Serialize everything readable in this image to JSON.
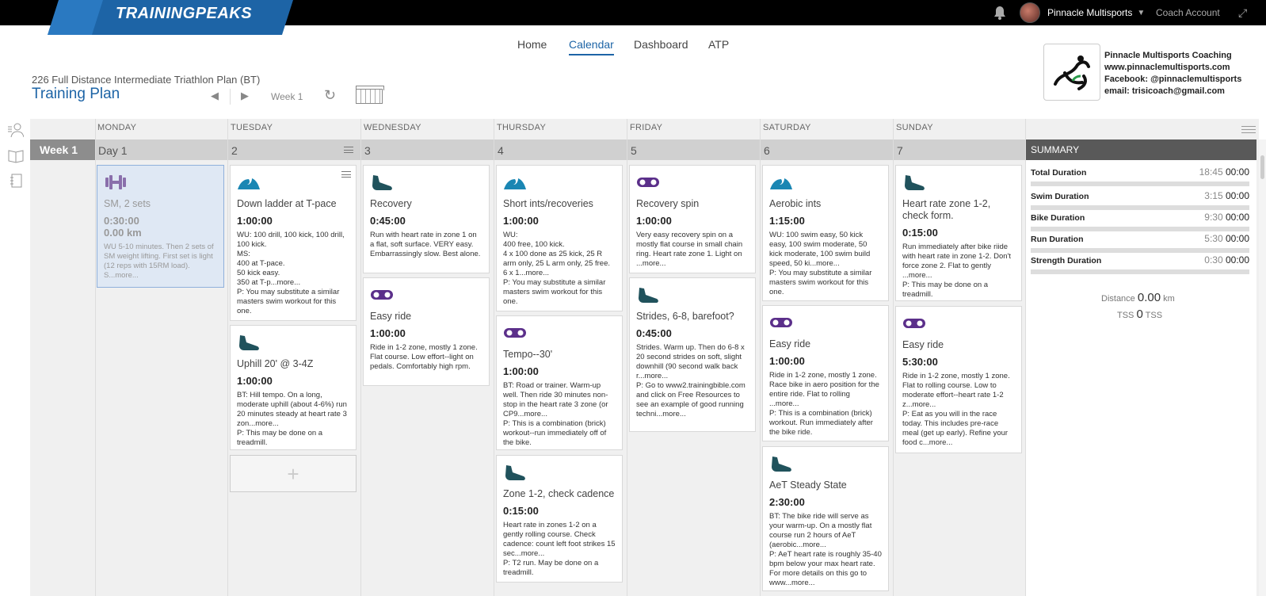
{
  "brand": "TRAININGPEAKS",
  "topbar": {
    "account_name": "Pinnacle Multisports",
    "coach_account": "Coach Account"
  },
  "nav": [
    {
      "label": "Home"
    },
    {
      "label": "Calendar"
    },
    {
      "label": "Dashboard"
    },
    {
      "label": "ATP"
    }
  ],
  "plan": {
    "subtitle": "226 Full Distance Intermediate Triathlon Plan (BT)",
    "title": "Training Plan",
    "week_label": "Week 1"
  },
  "coach_info": {
    "name": "Pinnacle Multisports Coaching",
    "website": "www.pinnaclemultisports.com",
    "facebook": "Facebook: @pinnaclemultisports",
    "email": "email: trisicoach@gmail.com"
  },
  "days": [
    "MONDAY",
    "TUESDAY",
    "WEDNESDAY",
    "THURSDAY",
    "FRIDAY",
    "SATURDAY",
    "SUNDAY"
  ],
  "week": {
    "label": "Week 1",
    "day_numbers": [
      "Day 1",
      "2",
      "3",
      "4",
      "5",
      "6",
      "7"
    ]
  },
  "colors": {
    "swim": "#1a86b3",
    "bike": "#5b2f8a",
    "run": "#20525c",
    "strength": "#8a6fab",
    "accent": "#1d64a6"
  },
  "workouts": {
    "mon_1": {
      "sport": "strength",
      "title": "SM, 2 sets",
      "duration": "0:30:00",
      "distance": "0.00",
      "distance_unit": "km",
      "description": "WU 5-10 minutes. Then 2 sets of SM weight lifting. First set is light (12 reps with 15RM load). S...more..."
    },
    "tue_1": {
      "sport": "swim",
      "title": "Down ladder at T-pace",
      "duration": "1:00:00",
      "description": "WU: 100 drill, 100 kick, 100 drill, 100 kick.\nMS:\n400 at T-pace.\n50 kick easy.\n350 at T-p...more...\nP: You may substitute a similar masters swim workout for this one."
    },
    "tue_2": {
      "sport": "run",
      "title": "Uphill 20' @ 3-4Z",
      "duration": "1:00:00",
      "description": "BT: Hill tempo. On a long, moderate uphill (about 4-6%) run 20 minutes steady at heart rate 3 zon...more...\nP: This may be done on a treadmill."
    },
    "wed_1": {
      "sport": "run",
      "title": "Recovery",
      "duration": "0:45:00",
      "description": "Run with heart rate in zone 1 on a flat, soft surface. VERY easy. Embarrassingly slow. Best alone."
    },
    "wed_2": {
      "sport": "bike",
      "title": "Easy ride",
      "duration": "1:00:00",
      "description": "Ride in 1-2 zone, mostly 1 zone. Flat course. Low effort--light on pedals. Comfortably high rpm."
    },
    "thu_1": {
      "sport": "swim",
      "title": "Short ints/recoveries",
      "duration": "1:00:00",
      "description": "WU:\n400 free, 100 kick.\n4 x 100 done as 25 kick, 25 R arm only, 25 L arm only, 25 free.\n6 x 1...more...\nP: You may substitute a similar masters swim workout for this one."
    },
    "thu_2": {
      "sport": "bike",
      "title": "Tempo--30'",
      "duration": "1:00:00",
      "description": "BT: Road or trainer. Warm-up well. Then ride 30 minutes non-stop in the heart rate 3 zone (or CP9...more...\nP: This is a combination (brick) workout--run immediately off of the bike."
    },
    "thu_3": {
      "sport": "run",
      "title": "Zone 1-2, check cadence",
      "duration": "0:15:00",
      "description": "Heart rate in zones 1-2 on a gently rolling course. Check cadence: count left foot strikes 15 sec...more...\nP: T2 run. May be done on a treadmill."
    },
    "fri_1": {
      "sport": "bike",
      "title": "Recovery spin",
      "duration": "1:00:00",
      "description": "Very easy recovery spin on a mostly flat course in small chain ring. Heart rate zone 1. Light on ...more..."
    },
    "fri_2": {
      "sport": "run",
      "title": "Strides, 6-8, barefoot?",
      "duration": "0:45:00",
      "description": "Strides. Warm up. Then do 6-8 x 20 second strides on soft, slight downhill (90 second walk back r...more...\nP: Go to www2.trainingbible.com and click on Free Resources to see an example of good running techni...more..."
    },
    "sat_1": {
      "sport": "swim",
      "title": "Aerobic ints",
      "duration": "1:15:00",
      "description": "WU: 100 swim easy, 50 kick easy, 100 swim moderate, 50 kick moderate, 100 swim build speed, 50 ki...more...\nP: You may substitute a similar masters swim workout for this one."
    },
    "sat_2": {
      "sport": "bike",
      "title": "Easy ride",
      "duration": "1:00:00",
      "description": "Ride in 1-2 zone, mostly 1 zone. Race bike in aero position for the entire ride. Flat to rolling ...more...\nP: This is a combination (brick) workout. Run immediately after the bike ride."
    },
    "sat_3": {
      "sport": "run",
      "title": "AeT Steady State",
      "duration": "2:30:00",
      "description": "BT: The bike ride will serve as your warm-up. On a mostly flat course run 2 hours of AeT (aerobic...more...\nP: AeT heart rate is roughly 35-40 bpm below your max heart rate. For more details on this go to www...more..."
    },
    "sun_1": {
      "sport": "run",
      "title": "Heart rate zone 1-2, check form.",
      "duration": "0:15:00",
      "description": "Run immediately after bike riide with heart rate in zone 1-2. Don't force zone 2. Flat to gently ...more...\nP: This may be done on a treadmill."
    },
    "sun_2": {
      "sport": "bike",
      "title": "Easy ride",
      "duration": "5:30:00",
      "description": "Ride in 1-2 zone, mostly 1 zone. Flat to rolling course. Low to moderate effort--heart rate 1-2 z...more...\nP: Eat as you will in the race today. This includes pre-race meal (get up early). Refine your food c...more..."
    }
  },
  "summary": {
    "header": "SUMMARY",
    "rows": [
      {
        "label": "Total Duration",
        "planned": "18:45",
        "completed": "00:00"
      },
      {
        "label": "Swim Duration",
        "planned": "3:15",
        "completed": "00:00"
      },
      {
        "label": "Bike Duration",
        "planned": "9:30",
        "completed": "00:00"
      },
      {
        "label": "Run Duration",
        "planned": "5:30",
        "completed": "00:00"
      },
      {
        "label": "Strength Duration",
        "planned": "0:30",
        "completed": "00:00"
      }
    ],
    "distance_label": "Distance",
    "distance_value": "0.00",
    "distance_unit": "km",
    "tss_label": "TSS",
    "tss_value": "0",
    "tss_unit": "TSS"
  }
}
